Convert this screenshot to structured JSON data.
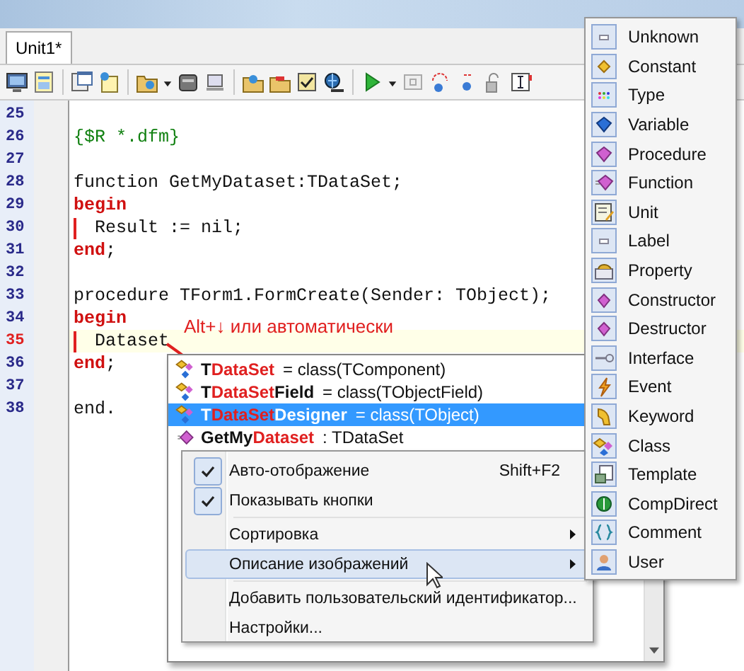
{
  "tab": {
    "label": "Unit1*",
    "selected": true
  },
  "editor": {
    "lines": [
      {
        "number": "25"
      },
      {
        "number": "26",
        "tokens": [
          {
            "kind": "comment",
            "text": "{$R *.dfm}"
          }
        ]
      },
      {
        "number": "27"
      },
      {
        "number": "28",
        "tokens": [
          {
            "kind": "plain",
            "text": "function GetMyDataset:TDataSet;"
          }
        ]
      },
      {
        "number": "29",
        "tokens": [
          {
            "kind": "keyword",
            "text": "begin"
          }
        ]
      },
      {
        "number": "30",
        "structure_bar": true,
        "tokens": [
          {
            "kind": "plain",
            "text": "Result := nil;"
          }
        ]
      },
      {
        "number": "31",
        "tokens": [
          {
            "kind": "keyword",
            "text": "end"
          },
          {
            "kind": "plain",
            "text": ";"
          }
        ]
      },
      {
        "number": "32"
      },
      {
        "number": "33",
        "tokens": [
          {
            "kind": "plain",
            "text": "procedure TForm1.FormCreate(Sender: TObject);"
          }
        ]
      },
      {
        "number": "34",
        "tokens": [
          {
            "kind": "keyword",
            "text": "begin"
          }
        ]
      },
      {
        "number": "35",
        "structure_bar": true,
        "current": true,
        "tokens": [
          {
            "kind": "plain",
            "text": "Dataset"
          }
        ]
      },
      {
        "number": "36",
        "tokens": [
          {
            "kind": "keyword",
            "text": "end"
          },
          {
            "kind": "plain",
            "text": ";"
          }
        ]
      },
      {
        "number": "37"
      },
      {
        "number": "38",
        "tokens": [
          {
            "kind": "plain",
            "text": "end."
          }
        ]
      }
    ]
  },
  "annotation": {
    "text": "Alt+↓ или автоматически"
  },
  "completion": {
    "rows": [
      {
        "kind": "class",
        "prefix": "T",
        "match": "DataSet",
        "detail": "= class(TComponent)",
        "selected": false
      },
      {
        "kind": "class",
        "prefix": "T",
        "match": "DataSet",
        "suffix": "Field",
        "detail": "= class(TObjectField)",
        "selected": false
      },
      {
        "kind": "class",
        "prefix": "T",
        "match": "DataSet",
        "suffix": "Designer",
        "detail": "= class(TObject)",
        "selected": true
      },
      {
        "kind": "function",
        "prefix": "GetMy",
        "match": "Dataset",
        "detail": ": TDataSet",
        "selected": false
      }
    ]
  },
  "context_menu": {
    "items": [
      {
        "kind": "item",
        "label": "Авто-отображение",
        "shortcut": "Shift+F2",
        "checked": true,
        "has_submenu": false,
        "selected": false
      },
      {
        "kind": "item",
        "label": "Показывать кнопки",
        "checked": true,
        "has_submenu": false,
        "selected": false
      },
      {
        "kind": "separator"
      },
      {
        "kind": "item",
        "label": "Сортировка",
        "checked": false,
        "has_submenu": true,
        "selected": false
      },
      {
        "kind": "item",
        "label": "Описание изображений",
        "checked": false,
        "has_submenu": true,
        "selected": true
      },
      {
        "kind": "separator"
      },
      {
        "kind": "item",
        "label": "Добавить пользовательский идентификатор...",
        "checked": false,
        "has_submenu": false,
        "selected": false
      },
      {
        "kind": "item",
        "label": "Настройки...",
        "checked": false,
        "has_submenu": false,
        "selected": false
      }
    ]
  },
  "submenu": {
    "items": [
      "Unknown",
      "Constant",
      "Type",
      "Variable",
      "Procedure",
      "Function",
      "Unit",
      "Label",
      "Property",
      "Constructor",
      "Destructor",
      "Interface",
      "Event",
      "Keyword",
      "Class",
      "Template",
      "CompDirect",
      "Comment",
      "User"
    ]
  }
}
